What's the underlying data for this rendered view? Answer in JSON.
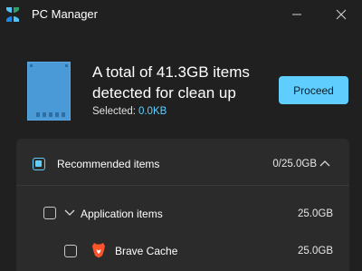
{
  "window": {
    "title": "PC Manager"
  },
  "summary": {
    "headline": "A total of 41.3GB items detected for clean up",
    "selected_label": "Selected:",
    "selected_value": "0.0KB",
    "proceed_label": "Proceed"
  },
  "groups": {
    "recommended": {
      "label": "Recommended items",
      "size": "0/25.0GB",
      "expanded": true,
      "checked": "indeterminate"
    },
    "application": {
      "label": "Application items",
      "size": "25.0GB",
      "checked": false
    },
    "brave": {
      "label": "Brave Cache",
      "size": "25.0GB",
      "icon": "brave-lion-icon",
      "checked": false
    }
  },
  "colors": {
    "background": "#202020",
    "panel": "#2b2b2b",
    "accent": "#60cdff",
    "brave": "#fb542b"
  }
}
